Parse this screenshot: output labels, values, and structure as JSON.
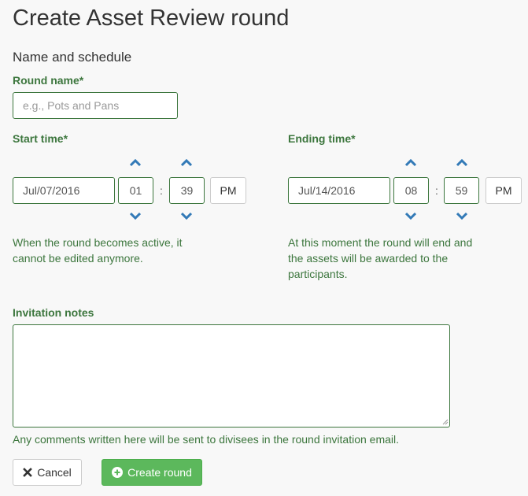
{
  "page": {
    "title": "Create Asset Review round",
    "section_title": "Name and schedule"
  },
  "round_name": {
    "label": "Round name*",
    "placeholder": "e.g., Pots and Pans",
    "value": ""
  },
  "start": {
    "label": "Start time*",
    "date": "Jul/07/2016",
    "hour": "01",
    "minute": "39",
    "ampm": "PM",
    "help": "When the round becomes active, it cannot be edited anymore."
  },
  "end": {
    "label": "Ending time*",
    "date": "Jul/14/2016",
    "hour": "08",
    "minute": "59",
    "ampm": "PM",
    "help": "At this moment the round will end and the assets will be awarded to the participants."
  },
  "time_separator": ":",
  "invitation": {
    "label": "Invitation notes",
    "value": "",
    "help": "Any comments written here will be sent to divisees in the round invitation email."
  },
  "actions": {
    "cancel_label": "Cancel",
    "create_label": "Create round"
  },
  "colors": {
    "label_green": "#3c763d",
    "link_blue": "#337ab7",
    "success": "#5cb85c"
  },
  "icons": {
    "increment": "chevron-up-icon",
    "decrement": "chevron-down-icon",
    "cancel": "close-icon",
    "create": "plus-circle-icon"
  }
}
